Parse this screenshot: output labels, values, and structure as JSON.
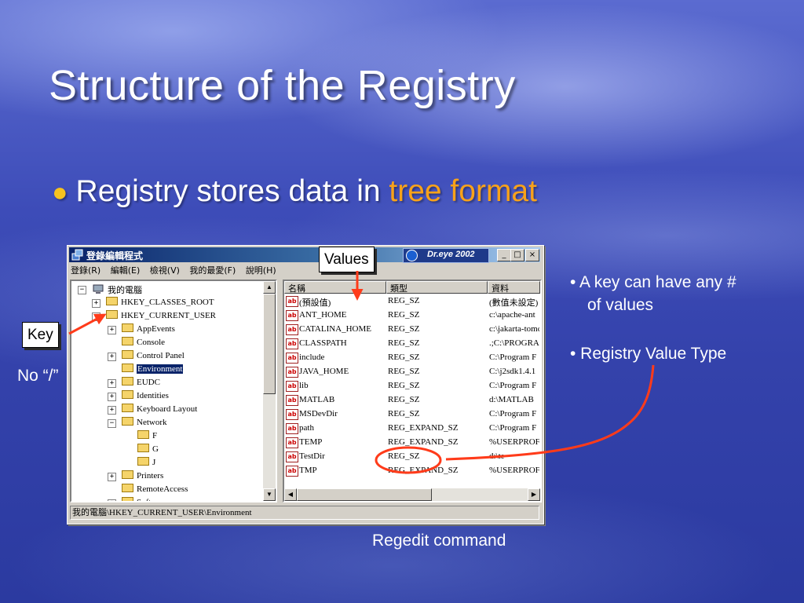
{
  "slide": {
    "title": "Structure of the Registry",
    "bullet_prefix": "Registry stores data in ",
    "bullet_highlight": "tree format",
    "note_key_line1": "• A key can have any #",
    "note_key_line2": "of values",
    "note_type": "• Registry Value Type",
    "callout_values": "Values",
    "callout_key": "Key",
    "no_slash": "No “/”",
    "caption": "Regedit command",
    "colors": {
      "highlight": "#f8a21a",
      "bullet_dot": "#f7c21e",
      "arrow": "#ff3b1a"
    }
  },
  "window": {
    "title": "登錄編輯程式",
    "dreye": "Dr.eye 2002",
    "controls": {
      "minimize": "_",
      "maximize": "□",
      "close": "×"
    },
    "menu": [
      "登錄(R)",
      "編輯(E)",
      "檢視(V)",
      "我的最愛(F)",
      "說明(H)"
    ],
    "tree": {
      "root": "我的電腦",
      "items": [
        {
          "label": "HKEY_CLASSES_ROOT",
          "pm": "+"
        },
        {
          "label": "HKEY_CURRENT_USER",
          "pm": "−"
        },
        {
          "label": "AppEvents",
          "pm": "+"
        },
        {
          "label": "Console",
          "pm": ""
        },
        {
          "label": "Control Panel",
          "pm": "+"
        },
        {
          "label": "Environment",
          "pm": "",
          "selected": true
        },
        {
          "label": "EUDC",
          "pm": "+"
        },
        {
          "label": "Identities",
          "pm": "+"
        },
        {
          "label": "Keyboard Layout",
          "pm": "+"
        },
        {
          "label": "Network",
          "pm": "−"
        },
        {
          "label": "F",
          "pm": ""
        },
        {
          "label": "G",
          "pm": ""
        },
        {
          "label": "J",
          "pm": ""
        },
        {
          "label": "Printers",
          "pm": "+"
        },
        {
          "label": "RemoteAccess",
          "pm": ""
        },
        {
          "label": "Software",
          "pm": "+"
        }
      ]
    },
    "list": {
      "headers": [
        "名稱",
        "類型",
        "資料"
      ],
      "rows": [
        {
          "name": "(預設值)",
          "type": "REG_SZ",
          "data": "(數值未設定)"
        },
        {
          "name": "ANT_HOME",
          "type": "REG_SZ",
          "data": "c:\\apache-ant"
        },
        {
          "name": "CATALINA_HOME",
          "type": "REG_SZ",
          "data": "c:\\jakarta-tomcat"
        },
        {
          "name": "CLASSPATH",
          "type": "REG_SZ",
          "data": ".;C:\\PROGRA"
        },
        {
          "name": "include",
          "type": "REG_SZ",
          "data": "C:\\Program F"
        },
        {
          "name": "JAVA_HOME",
          "type": "REG_SZ",
          "data": "C:\\j2sdk1.4.1"
        },
        {
          "name": "lib",
          "type": "REG_SZ",
          "data": "C:\\Program F"
        },
        {
          "name": "MATLAB",
          "type": "REG_SZ",
          "data": "d:\\MATLAB"
        },
        {
          "name": "MSDevDir",
          "type": "REG_SZ",
          "data": "C:\\Program F"
        },
        {
          "name": "path",
          "type": "REG_EXPAND_SZ",
          "data": "C:\\Program F"
        },
        {
          "name": "TEMP",
          "type": "REG_EXPAND_SZ",
          "data": "%USERPROFILE%"
        },
        {
          "name": "TestDir",
          "type": "REG_SZ",
          "data": "d:\\te"
        },
        {
          "name": "TMP",
          "type": "REG_EXPAND_SZ",
          "data": "%USERPROFILE%"
        }
      ]
    },
    "status": "我的電腦\\HKEY_CURRENT_USER\\Environment"
  }
}
